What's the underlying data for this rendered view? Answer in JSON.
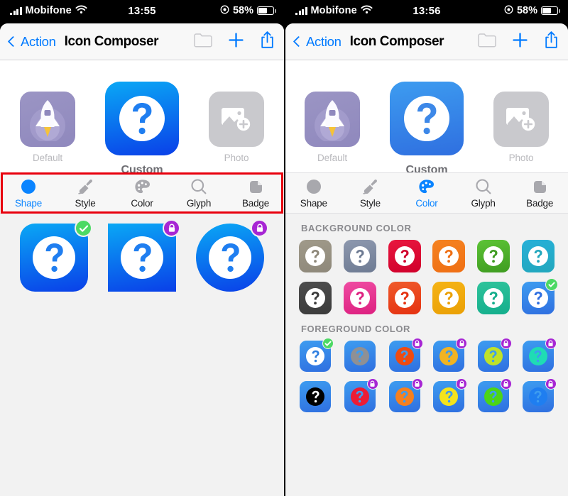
{
  "panels": [
    {
      "id": "left",
      "statusbar": {
        "carrier": "Mobifone",
        "time": "13:55",
        "battery_pct": "58%"
      },
      "navbar": {
        "back_label": "Action",
        "title": "Icon Composer",
        "folder_icon": "folder-icon",
        "add_icon": "plus-icon",
        "share_icon": "share-icon"
      },
      "preview": {
        "items": [
          {
            "label": "Default",
            "type": "rocket",
            "selected": false
          },
          {
            "label": "Custom",
            "type": "question",
            "selected": true
          },
          {
            "label": "Photo",
            "type": "photo",
            "selected": false
          }
        ],
        "custom_bg_top": "#0aa8f5",
        "custom_bg_bottom": "#0a3fe8"
      },
      "tabs": [
        {
          "label": "Shape",
          "icon": "circle-shape-icon",
          "active": true
        },
        {
          "label": "Style",
          "icon": "paintbrush-icon",
          "active": false
        },
        {
          "label": "Color",
          "icon": "palette-icon",
          "active": false
        },
        {
          "label": "Glyph",
          "icon": "magnifier-icon",
          "active": false
        },
        {
          "label": "Badge",
          "icon": "badge-corner-icon",
          "active": false
        }
      ],
      "highlight_box": {
        "color": "#e8000d",
        "around": "tab-bar"
      },
      "shape_options": [
        {
          "name": "rounded-square",
          "badge": "check"
        },
        {
          "name": "square",
          "badge": "lock"
        },
        {
          "name": "circle",
          "badge": "lock"
        }
      ]
    },
    {
      "id": "right",
      "statusbar": {
        "carrier": "Mobifone",
        "time": "13:56",
        "battery_pct": "58%"
      },
      "navbar": {
        "back_label": "Action",
        "title": "Icon Composer",
        "folder_icon": "folder-icon",
        "add_icon": "plus-icon",
        "share_icon": "share-icon"
      },
      "preview": {
        "items": [
          {
            "label": "Default",
            "type": "rocket",
            "selected": false
          },
          {
            "label": "Custom",
            "type": "question",
            "selected": true
          },
          {
            "label": "Photo",
            "type": "photo",
            "selected": false
          }
        ],
        "custom_bg_top": "#3d9cf0",
        "custom_bg_bottom": "#2f6fe0"
      },
      "tabs": [
        {
          "label": "Shape",
          "icon": "circle-shape-icon",
          "active": false
        },
        {
          "label": "Style",
          "icon": "paintbrush-icon",
          "active": false
        },
        {
          "label": "Color",
          "icon": "palette-icon",
          "active": true
        },
        {
          "label": "Glyph",
          "icon": "magnifier-icon",
          "active": false
        },
        {
          "label": "Badge",
          "icon": "badge-corner-icon",
          "active": false
        }
      ],
      "sections": [
        {
          "title": "BACKGROUND COLOR",
          "swatches": [
            {
              "name": "khaki-gray",
              "top": "#a09a8a",
              "bottom": "#8e887a",
              "fg": "#ffffff",
              "badge": ""
            },
            {
              "name": "slate-blue",
              "top": "#8d98ae",
              "bottom": "#6e7b93",
              "fg": "#ffffff",
              "badge": ""
            },
            {
              "name": "crimson",
              "top": "#e8173f",
              "bottom": "#d0002b",
              "fg": "#ffffff",
              "badge": ""
            },
            {
              "name": "orange",
              "top": "#f58220",
              "bottom": "#ef6f14",
              "fg": "#ffffff",
              "badge": ""
            },
            {
              "name": "green",
              "top": "#5cc335",
              "bottom": "#3f9c21",
              "fg": "#ffffff",
              "badge": ""
            },
            {
              "name": "cyan",
              "top": "#27b0d8",
              "bottom": "#22a7bd",
              "fg": "#ffffff",
              "badge": ""
            },
            {
              "name": "dark-gray",
              "top": "#4e4e4e",
              "bottom": "#3b3b3b",
              "fg": "#ffffff",
              "badge": ""
            },
            {
              "name": "pink",
              "top": "#ef4ba2",
              "bottom": "#dd2080",
              "fg": "#ffffff",
              "badge": ""
            },
            {
              "name": "red-orange",
              "top": "#ef5a2b",
              "bottom": "#e53211",
              "fg": "#ffffff",
              "badge": ""
            },
            {
              "name": "amber",
              "top": "#f5b315",
              "bottom": "#eaa005",
              "fg": "#ffffff",
              "badge": ""
            },
            {
              "name": "teal-green",
              "top": "#2ec39b",
              "bottom": "#14ae8c",
              "fg": "#ffffff",
              "badge": ""
            },
            {
              "name": "blue",
              "top": "#3d9cf0",
              "bottom": "#2f6fe0",
              "fg": "#ffffff",
              "badge": "check"
            }
          ]
        },
        {
          "title": "FOREGROUND COLOR",
          "swatches": [
            {
              "name": "white",
              "top": "#3d9cf0",
              "bottom": "#2f6fe0",
              "fg": "#ffffff",
              "badge": "check"
            },
            {
              "name": "gray",
              "top": "#3d9cf0",
              "bottom": "#2f6fe0",
              "fg": "#8f9094",
              "badge": ""
            },
            {
              "name": "orange-red",
              "top": "#3d9cf0",
              "bottom": "#2f6fe0",
              "fg": "#ef4b10",
              "badge": "lock"
            },
            {
              "name": "amber",
              "top": "#3d9cf0",
              "bottom": "#2f6fe0",
              "fg": "#f0b323",
              "badge": "lock"
            },
            {
              "name": "lime",
              "top": "#3d9cf0",
              "bottom": "#2f6fe0",
              "fg": "#bfe229",
              "badge": "lock"
            },
            {
              "name": "turquoise",
              "top": "#3d9cf0",
              "bottom": "#2f6fe0",
              "fg": "#1fdcb4",
              "badge": "lock"
            },
            {
              "name": "black",
              "top": "#3d9cf0",
              "bottom": "#2f6fe0",
              "fg": "#000000",
              "badge": ""
            },
            {
              "name": "red",
              "top": "#3d9cf0",
              "bottom": "#2f6fe0",
              "fg": "#ec1c35",
              "badge": "lock"
            },
            {
              "name": "orange",
              "top": "#3d9cf0",
              "bottom": "#2f6fe0",
              "fg": "#f68020",
              "badge": "lock"
            },
            {
              "name": "yellow",
              "top": "#3d9cf0",
              "bottom": "#2f6fe0",
              "fg": "#f4e31d",
              "badge": "lock"
            },
            {
              "name": "green",
              "top": "#3d9cf0",
              "bottom": "#2f6fe0",
              "fg": "#4cd417",
              "badge": "lock"
            },
            {
              "name": "blue",
              "top": "#3d9cf0",
              "bottom": "#2f6fe0",
              "fg": "#1f7ef0",
              "badge": "lock"
            }
          ]
        }
      ]
    }
  ],
  "colors": {
    "accent": "#007aff",
    "tab_active": "#0a84ff",
    "highlight": "#e8000d",
    "check_badge": "#4cd964",
    "lock_badge": "#a726d4"
  }
}
